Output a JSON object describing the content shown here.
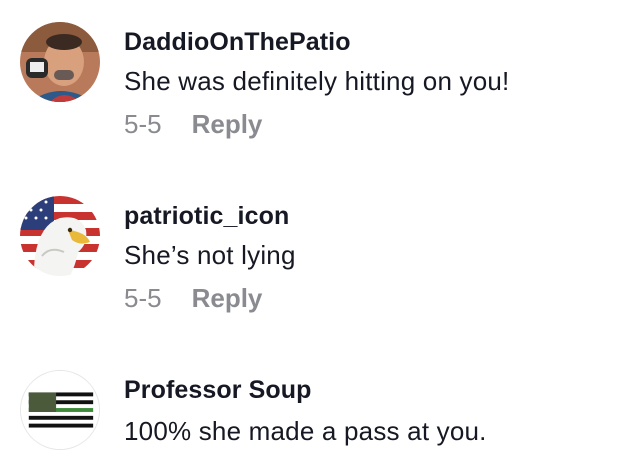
{
  "comments": [
    {
      "username": "DaddioOnThePatio",
      "text": "She was definitely hitting on you!",
      "date": "5-5",
      "reply_label": "Reply",
      "avatar_icon": "profile-photo-man-with-headset"
    },
    {
      "username": "patriotic_icon",
      "text": "She’s not lying",
      "date": "5-5",
      "reply_label": "Reply",
      "avatar_icon": "bald-eagle-american-flag"
    },
    {
      "username": "Professor Soup",
      "text": "100% she made a pass at you.",
      "avatar_icon": "green-line-flag"
    }
  ],
  "colors": {
    "text_primary": "#161823",
    "text_secondary": "#8a8b91",
    "background": "#ffffff"
  }
}
